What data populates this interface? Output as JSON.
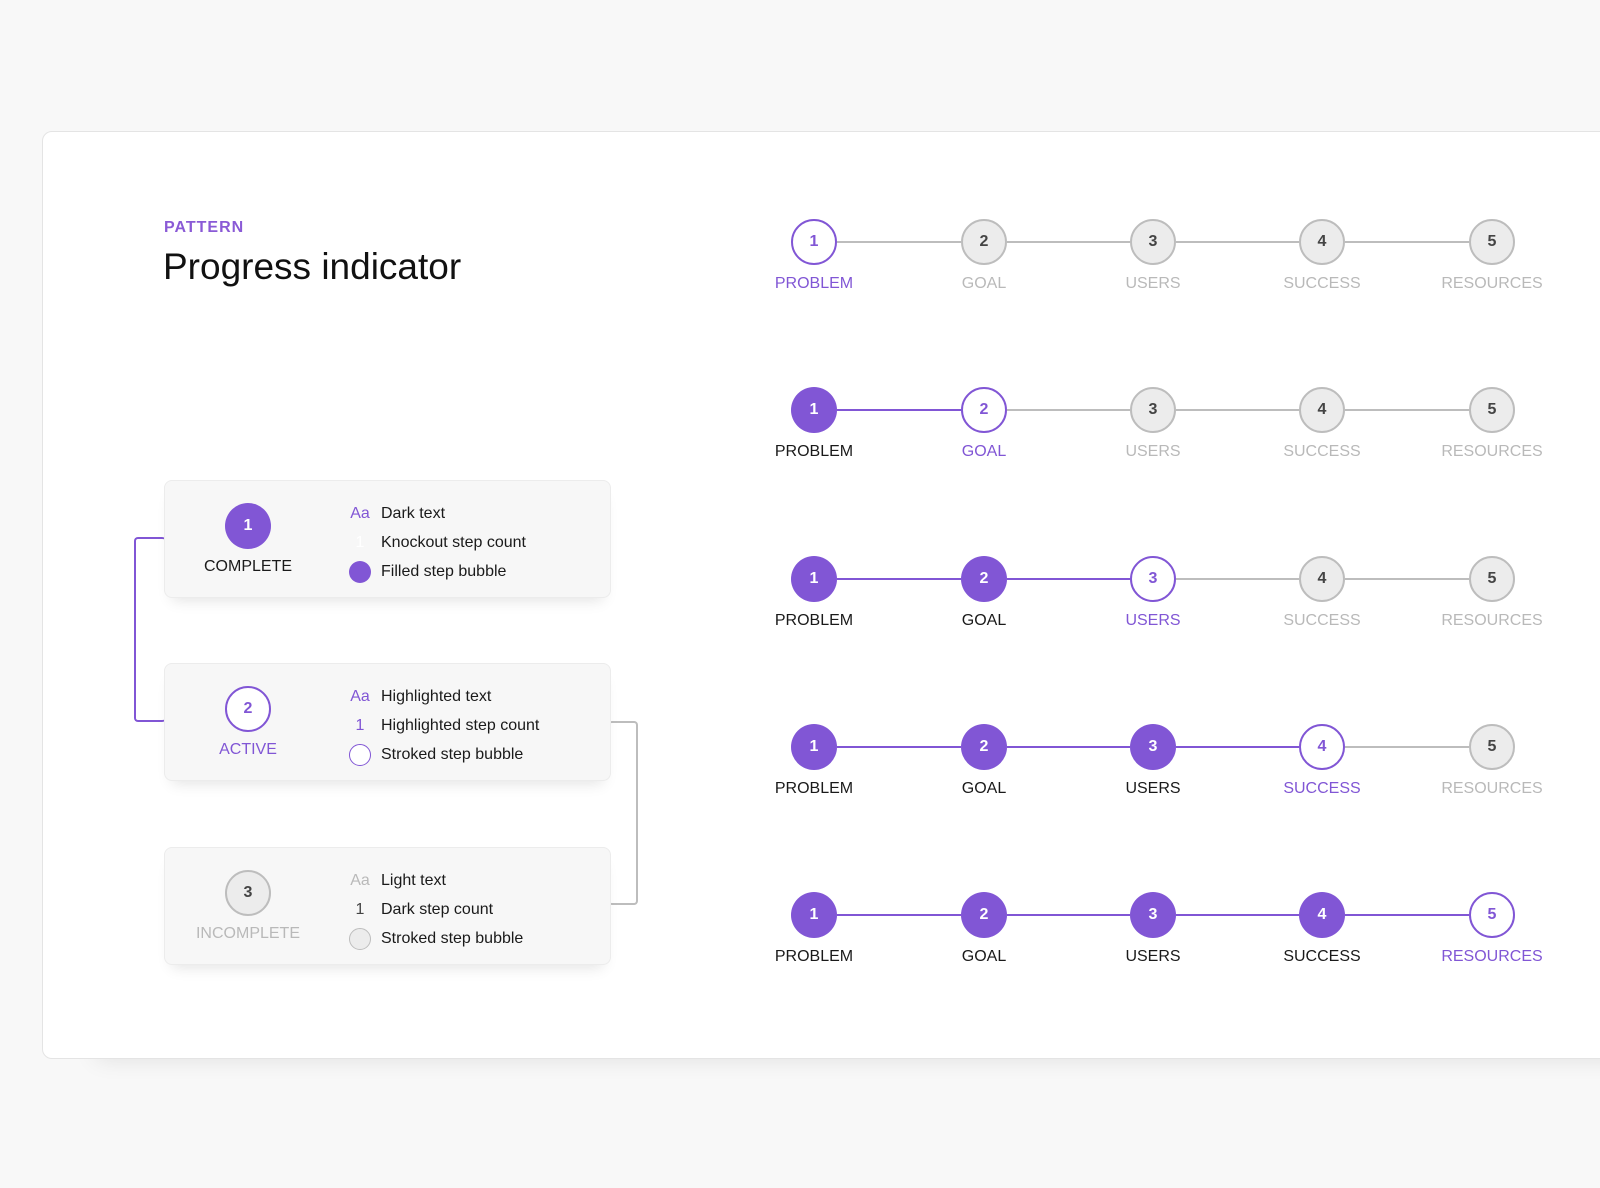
{
  "header": {
    "eyebrow": "PATTERN",
    "title": "Progress indicator"
  },
  "colors": {
    "accent": "#8156d5",
    "incomplete_stroke": "#bdbdbd",
    "incomplete_fill": "#ececec",
    "light_text": "#b9b9b9",
    "dark_text": "#1a1a1a"
  },
  "legend": [
    {
      "state": "COMPLETE",
      "number": "1",
      "rows": [
        {
          "swatch": "Aa",
          "label": "Dark text"
        },
        {
          "swatch": "1",
          "label": "Knockout step count"
        },
        {
          "swatch": "",
          "label": "Filled step bubble"
        }
      ]
    },
    {
      "state": "ACTIVE",
      "number": "2",
      "rows": [
        {
          "swatch": "Aa",
          "label": "Highlighted text"
        },
        {
          "swatch": "1",
          "label": "Highlighted step count"
        },
        {
          "swatch": "",
          "label": "Stroked step bubble"
        }
      ]
    },
    {
      "state": "INCOMPLETE",
      "number": "3",
      "rows": [
        {
          "swatch": "Aa",
          "label": "Light text"
        },
        {
          "swatch": "1",
          "label": "Dark step count"
        },
        {
          "swatch": "",
          "label": "Stroked step bubble"
        }
      ]
    }
  ],
  "steps": [
    {
      "number": "1",
      "label": "PROBLEM"
    },
    {
      "number": "2",
      "label": "GOAL"
    },
    {
      "number": "3",
      "label": "USERS"
    },
    {
      "number": "4",
      "label": "SUCCESS"
    },
    {
      "number": "5",
      "label": "RESOURCES"
    }
  ],
  "examples": [
    {
      "active_step": 1
    },
    {
      "active_step": 2
    },
    {
      "active_step": 3
    },
    {
      "active_step": 4
    },
    {
      "active_step": 5
    }
  ]
}
